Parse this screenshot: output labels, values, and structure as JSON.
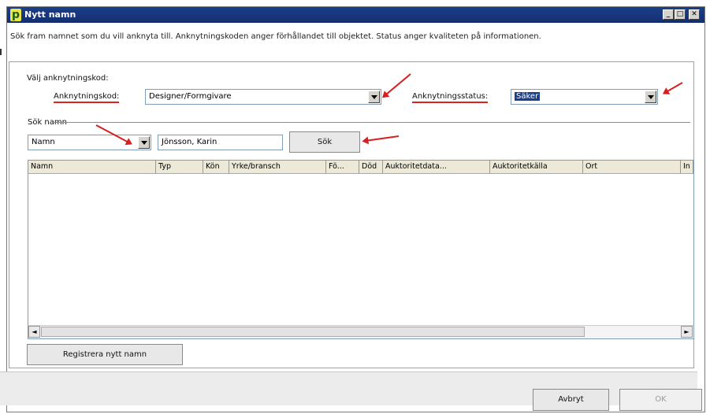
{
  "window": {
    "title": "Nytt namn",
    "app_icon_glyph": "p",
    "controls": {
      "minimize": "_",
      "maximize": "□",
      "close": "✕"
    }
  },
  "description": "Sök fram namnet som du vill anknyta till. Anknytningskoden anger förhållandet till objektet. Status anger kvaliteten på informationen.",
  "section_label": "Välj anknytningskod:",
  "anknytningskod": {
    "label": "Anknytningskod:",
    "value": "Designer/Formgivare"
  },
  "anknytningsstatus": {
    "label": "Anknytningsstatus:",
    "value": "Säker"
  },
  "search": {
    "group_label": "Sök namn",
    "field_type": "Namn",
    "query": "Jönsson, Karin",
    "button_label": "Sök"
  },
  "table": {
    "columns": [
      "Namn",
      "Typ",
      "Kön",
      "Yrke/bransch",
      "Fö...",
      "Död",
      "Auktoritetdata...",
      "Auktoritetkälla",
      "Ort",
      "In"
    ],
    "rows": []
  },
  "register_button": "Registrera nytt namn",
  "footer": {
    "cancel": "Avbryt",
    "ok": "OK"
  },
  "colors": {
    "titlebar": "#1c3f8a",
    "annotation": "#d42020",
    "selection": "#1c3f8a"
  }
}
